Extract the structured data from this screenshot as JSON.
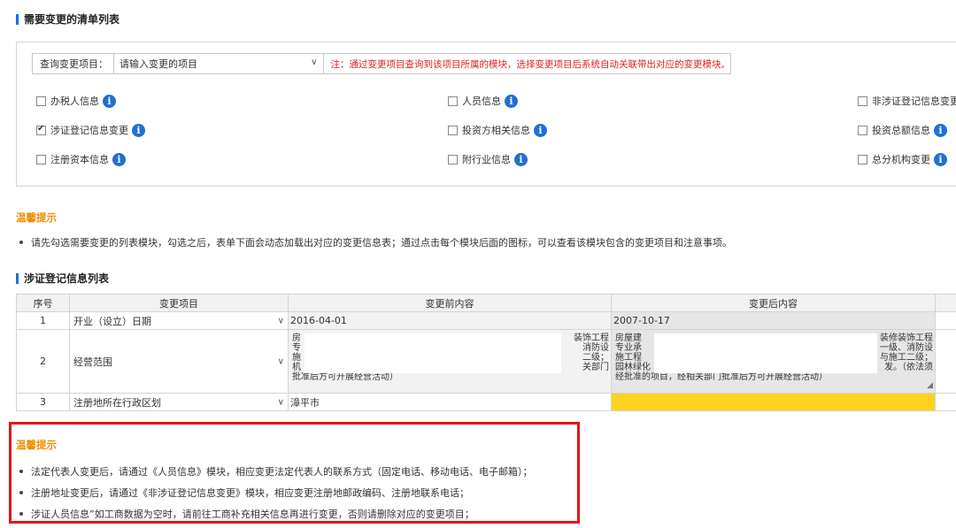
{
  "sections": {
    "change_list_title": "需要变更的清单列表",
    "registration_list_title": "涉证登记信息列表"
  },
  "query": {
    "label": "查询变更项目：",
    "placeholder": "请输入变更的项目",
    "note": "注：通过变更项目查询到该项目所属的模块，选择变更项目后系统自动关联带出对应的变更模块。"
  },
  "modules": [
    {
      "label": "办税人信息",
      "checked": false
    },
    {
      "label": "人员信息",
      "checked": false
    },
    {
      "label": "非涉证登记信息变更",
      "checked": false
    },
    {
      "label": "涉证登记信息变更",
      "checked": true
    },
    {
      "label": "投资方相关信息",
      "checked": false
    },
    {
      "label": "投资总额信息",
      "checked": false
    },
    {
      "label": "注册资本信息",
      "checked": false
    },
    {
      "label": "附行业信息",
      "checked": false
    },
    {
      "label": "总分机构变更",
      "checked": false
    }
  ],
  "tip1": {
    "title": "温馨提示",
    "lines": [
      "请先勾选需要变更的列表模块，勾选之后，表单下面会动态加载出对应的变更信息表；通过点击每个模块后面的图标，可以查看该模块包含的变更项目和注意事项。"
    ]
  },
  "table": {
    "headers": [
      "序号",
      "变更项目",
      "变更前内容",
      "变更后内容"
    ],
    "rows": [
      {
        "no": "1",
        "item": "开业（设立）日期",
        "before": "2016-04-01",
        "after": "2007-10-17"
      },
      {
        "no": "2",
        "item": "经营范围",
        "before_lines": [
          "房",
          "专",
          "施",
          "机",
          "批准后方可开展经营活动）"
        ],
        "before_right": [
          "装饰工程",
          "消防设",
          "二级；",
          "关部门"
        ],
        "after_lines": [
          "房屋建",
          "专业承",
          "施工程",
          "园林绿化",
          "经批准的项目，经相关部门批准后方可开展经营活动）"
        ],
        "after_right": [
          "装修装饰工程",
          "一级、消防设",
          "与施工二级；",
          "发。（依法须"
        ]
      },
      {
        "no": "3",
        "item": "注册地所在行政区划",
        "before": "漳平市",
        "after": ""
      }
    ]
  },
  "tip2": {
    "title": "温馨提示",
    "lines": [
      "法定代表人变更后，请通过《人员信息》模块，相应变更法定代表人的联系方式（固定电话、移动电话、电子邮箱）；",
      "注册地址变更后，请通过《非涉证登记信息变更》模块，相应变更注册地邮政编码、注册地联系电话；",
      "涉证人员信息”如工商数据为空时，请前往工商补充相关信息再进行变更，否则请删除对应的变更项目；"
    ]
  },
  "colors": {
    "accent": "#1f6fd6",
    "warning": "#f08c00",
    "highlight": "#ffd21f",
    "alert_border": "#e0161c"
  }
}
